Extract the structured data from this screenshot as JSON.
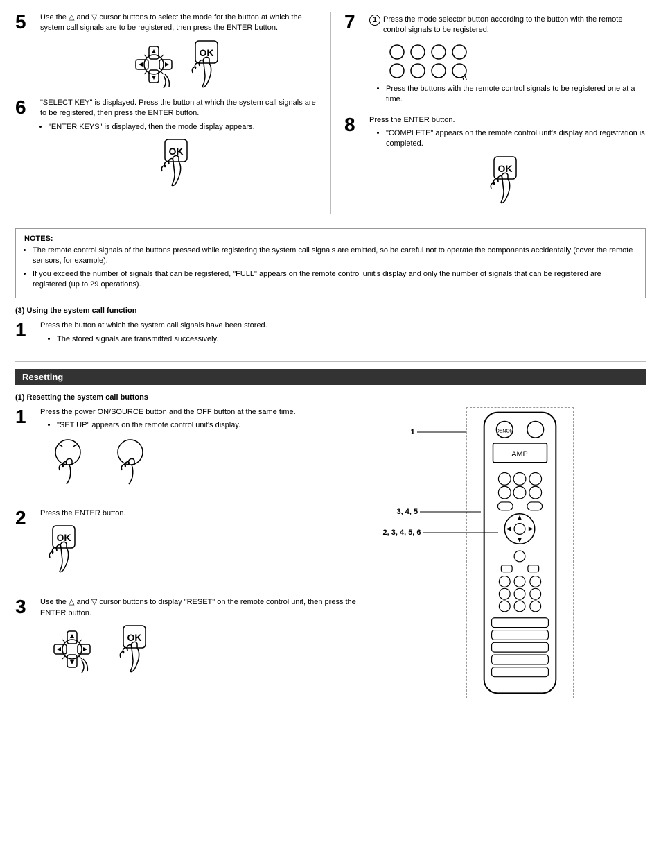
{
  "steps": {
    "step5": {
      "number": "5",
      "text": "Use the △ and ▽ cursor buttons to select the mode for the button at which the system call signals are to be registered, then press the ENTER button."
    },
    "step6": {
      "number": "6",
      "text": "\"SELECT KEY\" is displayed. Press the button at which the system call signals are to be registered, then press the ENTER button.",
      "bullet": "\"ENTER KEYS\" is displayed, then the mode display appears."
    },
    "step7": {
      "number": "7",
      "bullet1": "Press the mode selector button according to the button with the remote control signals to be registered.",
      "bullet2": "Press the buttons with the remote control signals to be registered one at a time."
    },
    "step8": {
      "number": "8",
      "text": "Press the ENTER button.",
      "bullet": "\"COMPLETE\" appears on the remote control unit's display and registration is completed."
    }
  },
  "notes": {
    "title": "NOTES:",
    "items": [
      "The remote control signals of the buttons pressed while registering the system call signals are emitted, so be careful not to operate the components accidentally (cover the remote sensors, for example).",
      "If you exceed the number of signals that can be registered, \"FULL\" appears on the remote control unit's display and only the number of signals that can be registered are registered (up to 29 operations)."
    ]
  },
  "using_system_call": {
    "title": "(3) Using the system call function",
    "step1": {
      "number": "1",
      "text": "Press the button at which the system call signals have been stored.",
      "bullet": "The stored signals are transmitted successively."
    }
  },
  "resetting": {
    "header": "Resetting",
    "sub1_title": "(1) Resetting the system call buttons",
    "reset_step1": {
      "number": "1",
      "text": "Press the power ON/SOURCE button and the OFF button at the same time.",
      "bullet": "\"SET UP\" appears on the remote control unit's display."
    },
    "reset_step2": {
      "number": "2",
      "text": "Press the ENTER button."
    },
    "reset_step3": {
      "number": "3",
      "text": "Use the △ and ▽ cursor buttons to display \"RESET\" on the remote control unit, then press the ENTER button."
    },
    "remote_labels": {
      "label1": "1",
      "label2": "3, 4, 5",
      "label3": "2, 3, 4, 5, 6"
    }
  }
}
